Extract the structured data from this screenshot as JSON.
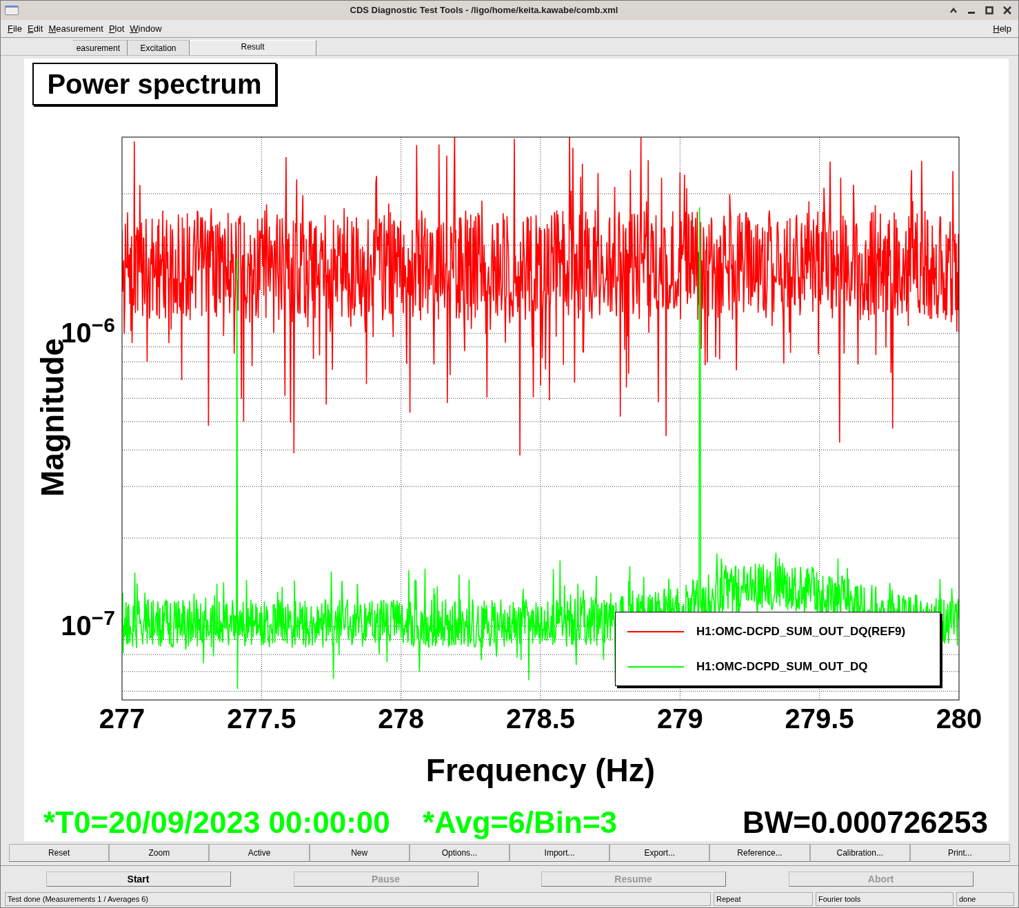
{
  "window": {
    "title": "CDS Diagnostic Test Tools - /ligo/home/keita.kawabe/comb.xml"
  },
  "menu": [
    "File",
    "Edit",
    "Measurement",
    "Plot",
    "Window"
  ],
  "help_menu": "Help",
  "tabs": [
    {
      "label": "easurement",
      "selected": false
    },
    {
      "label": "Excitation",
      "selected": false
    },
    {
      "label": "Result",
      "selected": true
    }
  ],
  "plot": {
    "title": "Power spectrum",
    "ylabel": "Magnitude",
    "xlabel": "Frequency (Hz)",
    "xticks": [
      "277",
      "277.5",
      "278",
      "278.5",
      "279",
      "279.5",
      "280"
    ],
    "yticks": [
      "10$^{−6}$",
      "10$^{−7}$"
    ],
    "legend": [
      {
        "label": "H1:OMC-DCPD_SUM_OUT_DQ(REF9)",
        "color": "#ff0000"
      },
      {
        "label": "H1:OMC-DCPD_SUM_OUT_DQ",
        "color": "#00ff00"
      }
    ],
    "footer": {
      "t0": "*T0=20/09/2023 00:00:00",
      "avg": "*Avg=6/Bin=3",
      "bw": "BW=0.000726253"
    }
  },
  "tool_buttons": [
    "Reset",
    "Zoom",
    "Active",
    "New",
    "Options...",
    "Import...",
    "Export...",
    "Reference...",
    "Calibration...",
    "Print..."
  ],
  "action_buttons": [
    {
      "label": "Start",
      "disabled": false
    },
    {
      "label": "Pause",
      "disabled": true
    },
    {
      "label": "Resume",
      "disabled": true
    },
    {
      "label": "Abort",
      "disabled": true
    }
  ],
  "status_bar": {
    "message": "Test done (Measurements 1 / Averages 6)",
    "fields": [
      "Repeat",
      "Fourier tools",
      "done"
    ]
  }
}
